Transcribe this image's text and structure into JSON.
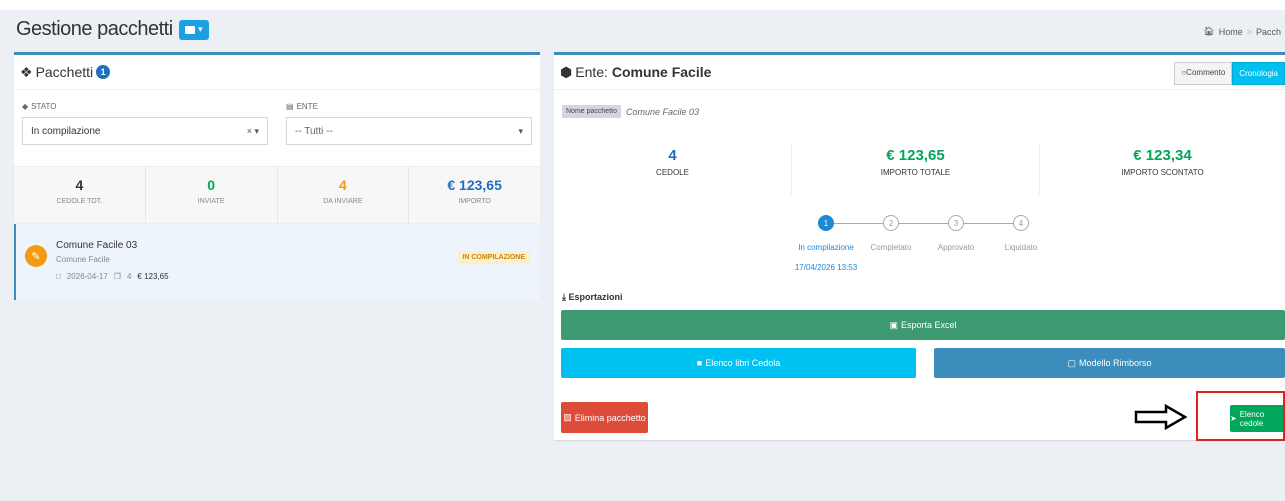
{
  "header": {
    "title": "Gestione pacchetti",
    "breadcrumb": [
      "Home",
      "Pacch"
    ]
  },
  "left_panel": {
    "title": "Pacchetti",
    "badge": "1",
    "filters": {
      "stato_label": "STATO",
      "stato_value": "In compilazione",
      "stato_clear": "×",
      "ente_label": "ENTE",
      "ente_value": "-- Tutti --"
    },
    "stats": [
      {
        "value": "4",
        "label": "CEDOLE TOT.",
        "color": "#333333"
      },
      {
        "value": "0",
        "label": "INVIATE",
        "color": "#00a65a"
      },
      {
        "value": "4",
        "label": "DA INVIARE",
        "color": "#f39c12"
      },
      {
        "value": "€ 123,65",
        "label": "IMPORTO",
        "color": "#1e6fbf"
      }
    ],
    "item": {
      "title": "Comune Facile 03",
      "subtitle": "Comune Facile",
      "date": "2026-04-17",
      "count": "4",
      "amount": "€ 123,65",
      "status": "IN COMPILAZIONE"
    }
  },
  "right_panel": {
    "title_prefix": "Ente:",
    "title_name": "Comune Facile",
    "btn_commento": "Commento",
    "btn_cronologia": "Cronologia",
    "nome_tag": "Nome pacchetto",
    "nome_value": "Comune Facile 03",
    "stats": [
      {
        "value": "4",
        "label": "CEDOLE"
      },
      {
        "value": "€ 123,65",
        "label": "IMPORTO TOTALE"
      },
      {
        "value": "€ 123,34",
        "label": "IMPORTO SCONTATO"
      }
    ],
    "steps": [
      {
        "num": "1",
        "label": "In compilazione",
        "active": true
      },
      {
        "num": "2",
        "label": "Completato",
        "active": false
      },
      {
        "num": "3",
        "label": "Approvato",
        "active": false
      },
      {
        "num": "4",
        "label": "Liquidato",
        "active": false
      }
    ],
    "step_date": "17/04/2026 13:53",
    "esportazioni": "Esportazioni",
    "btn_excel": "Esporta Excel",
    "btn_libri": "Elenco libri Cedola",
    "btn_modello": "Modello Rimborso",
    "btn_elimina": "Elimina pacchetto",
    "btn_elenco": "Elenco cedole"
  },
  "annotation_color": "#e0211e"
}
